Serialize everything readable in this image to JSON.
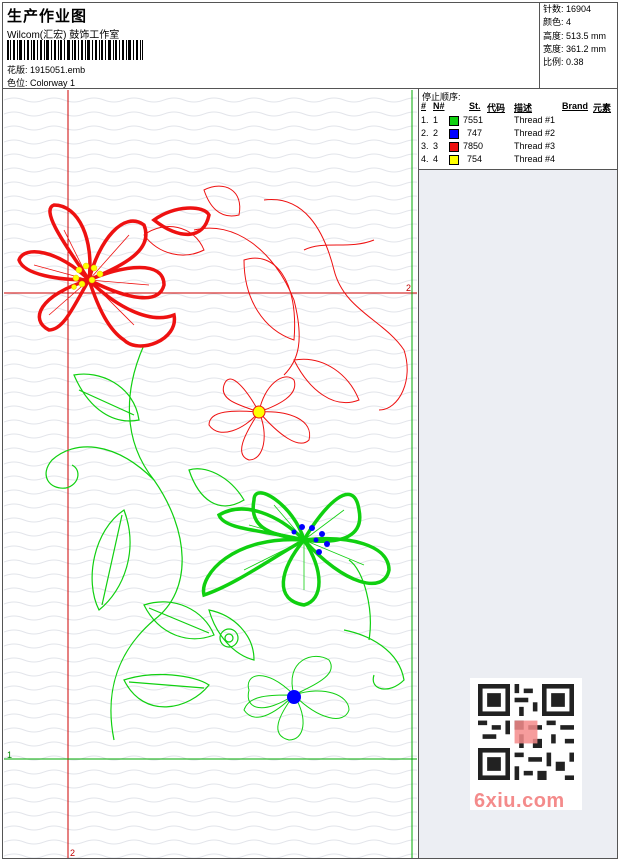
{
  "header": {
    "title": "生产作业图",
    "company": "Wilcom(汇宏) 鼓饰工作室",
    "pattern_label": "花版:",
    "pattern_value": "1915051.emb",
    "colorway_label": "色位:",
    "colorway_value": "Colorway 1"
  },
  "stats": [
    {
      "label": "针数:",
      "value": "16904"
    },
    {
      "label": "颜色:",
      "value": "4"
    },
    {
      "label": "高度:",
      "value": "513.5 mm"
    },
    {
      "label": "宽度:",
      "value": "361.2 mm"
    },
    {
      "label": "比例:",
      "value": "0.38"
    }
  ],
  "stop_sequence": {
    "heading": "停止顺序:",
    "columns": {
      "hash": "#",
      "n": "N#",
      "st": "St.",
      "code": "代码",
      "desc": "描述",
      "brand": "Brand",
      "element": "元素"
    },
    "rows": [
      {
        "idx": "1.",
        "n": "1",
        "color": "#10d010",
        "code": "7551",
        "desc": "Thread #1"
      },
      {
        "idx": "2.",
        "n": "2",
        "color": "#0000ff",
        "code": "747",
        "desc": "Thread #2"
      },
      {
        "idx": "3.",
        "n": "3",
        "color": "#ee1111",
        "code": "7850",
        "desc": "Thread #3"
      },
      {
        "idx": "4.",
        "n": "4",
        "color": "#ffff00",
        "code": "754",
        "desc": "Thread #4"
      }
    ]
  },
  "guides": {
    "red_h_label": "2",
    "red_v_label": "2",
    "green_h_label": "1"
  },
  "watermark": "6xiu.com",
  "colors": {
    "red": "#ee1111",
    "green": "#10d010",
    "blue": "#0000ff",
    "yellow": "#ffff00",
    "guide_red": "#cc0000",
    "guide_green": "#00aa00"
  }
}
